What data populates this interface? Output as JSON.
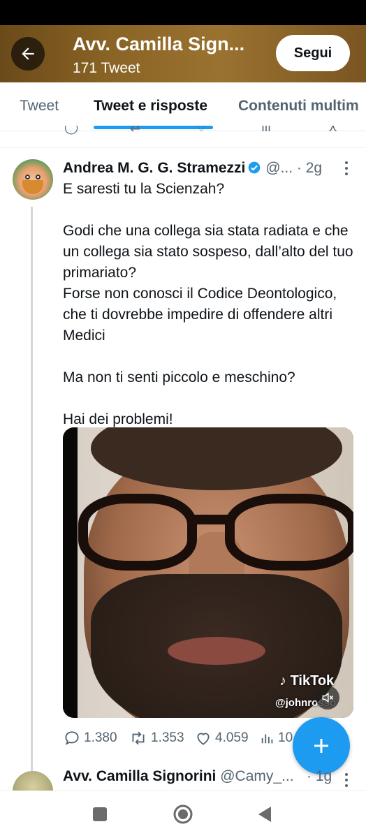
{
  "header": {
    "title": "Avv. Camilla Sign...",
    "subtitle": "171 Tweet",
    "follow_label": "Segui"
  },
  "tabs": [
    {
      "label": "Tweet",
      "selected": false
    },
    {
      "label": "Tweet e risposte",
      "selected": true
    },
    {
      "label": "Contenuti multim",
      "selected": false
    }
  ],
  "tweet": {
    "author_name": "Andrea M. G. G. Stramezzi",
    "author_handle": "@...",
    "time": "· 2g",
    "text": "E saresti tu la Scienzah?\n\nGodi che una collega sia stata radiata e che un collega sia stato sospeso, dall’alto del tuo primariato?\nForse non conosci il Codice Deontologico, che ti dovrebbe impedire di offendere altri Medici\n\nMa non ti senti piccolo e meschino?\n\nHai dei problemi!",
    "media": {
      "watermark_logo": "TikTok",
      "watermark_handle": "@johnrosso"
    },
    "stats": {
      "replies": "1.380",
      "retweets": "1.353",
      "likes": "4.059",
      "views": "10"
    }
  },
  "reply": {
    "author_name": "Avv. Camilla Signorini",
    "author_handle": "@Camy_...",
    "time": "· 1g"
  },
  "colors": {
    "accent": "#1d9bf0",
    "secondary_text": "#536471",
    "primary_text": "#0f1419"
  }
}
